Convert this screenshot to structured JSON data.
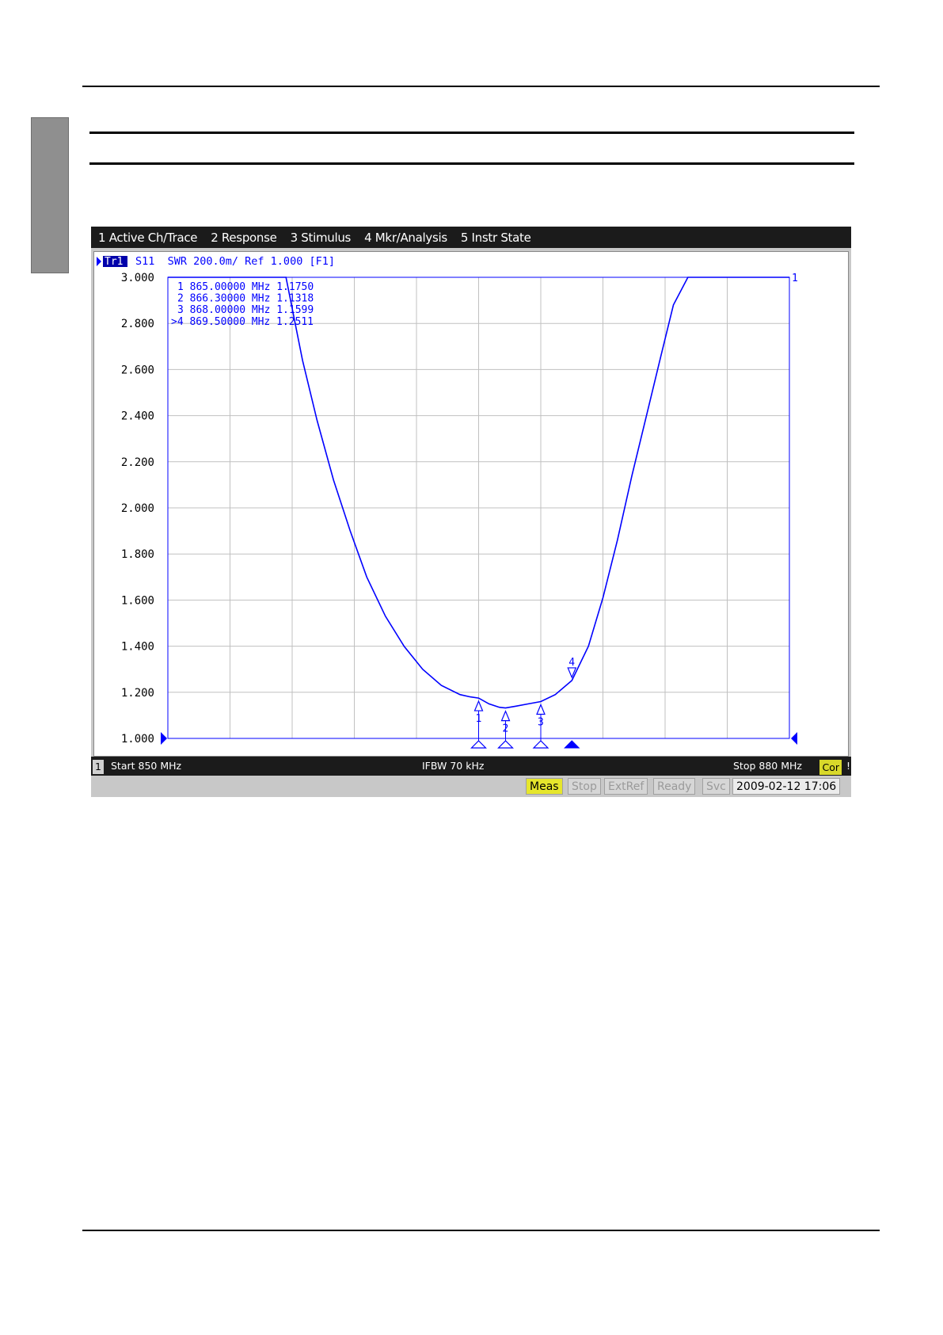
{
  "menu": {
    "items": [
      {
        "label": "1 Active Ch/Trace"
      },
      {
        "label": "2 Response"
      },
      {
        "label": "3 Stimulus"
      },
      {
        "label": "4 Mkr/Analysis"
      },
      {
        "label": "5 Instr State"
      }
    ]
  },
  "trace": {
    "tag": "Tr1",
    "header": "S11  SWR 200.0m/ Ref 1.000 [F1]",
    "end_label": "1"
  },
  "status": {
    "channel": "1",
    "start": "Start 850 MHz",
    "ifbw": "IFBW 70 kHz",
    "stop": "Stop 880 MHz",
    "cor": "Cor",
    "alert": "!"
  },
  "indicators": {
    "meas": "Meas",
    "stop": "Stop",
    "extref": "ExtRef",
    "ready": "Ready",
    "svc": "Svc",
    "datetime": "2009-02-12 17:06"
  },
  "colors": {
    "trace": "#0000ff",
    "grid": "#c0c0c0",
    "menubar": "#1b1b1b",
    "active_indicator": "#e6e62c"
  },
  "chart_data": {
    "type": "line",
    "xlim": [
      850,
      880
    ],
    "ylim": [
      1.0,
      3.0
    ],
    "x_divisions": 10,
    "ytick_labels": [
      "3.000",
      "2.800",
      "2.600",
      "2.400",
      "2.200",
      "2.000",
      "1.800",
      "1.600",
      "1.400",
      "1.200",
      "1.000"
    ],
    "grid": true,
    "series": [
      {
        "x": [
          850,
          855.7,
          856.5,
          857.2,
          858.0,
          858.8,
          859.6,
          860.5,
          861.4,
          862.3,
          863.2,
          864.1,
          864.6,
          865.0,
          865.5,
          866.0,
          866.3,
          866.8,
          867.4,
          868.0,
          868.7,
          869.5,
          870.3,
          871.0,
          871.7,
          872.4,
          873.1,
          873.8,
          874.4,
          875.1,
          880
        ],
        "y": [
          3.0,
          3.0,
          2.64,
          2.38,
          2.12,
          1.9,
          1.7,
          1.53,
          1.4,
          1.3,
          1.23,
          1.19,
          1.18,
          1.175,
          1.15,
          1.135,
          1.1318,
          1.14,
          1.15,
          1.1599,
          1.19,
          1.2511,
          1.4,
          1.61,
          1.86,
          2.14,
          2.4,
          2.66,
          2.88,
          3.0,
          3.0
        ]
      }
    ],
    "markers": [
      {
        "num": "1",
        "x": 865.0,
        "y": 1.175,
        "label": "1   865.00000 MHz   1.1750",
        "active": false
      },
      {
        "num": "2",
        "x": 866.3,
        "y": 1.1318,
        "label": "2   866.30000 MHz   1.1318",
        "active": false
      },
      {
        "num": "3",
        "x": 868.0,
        "y": 1.1599,
        "label": "3   868.00000 MHz   1.1599",
        "active": false
      },
      {
        "num": "4",
        "x": 869.5,
        "y": 1.2511,
        "label": ">4   869.50000 MHz   1.2511",
        "active": true
      }
    ]
  }
}
